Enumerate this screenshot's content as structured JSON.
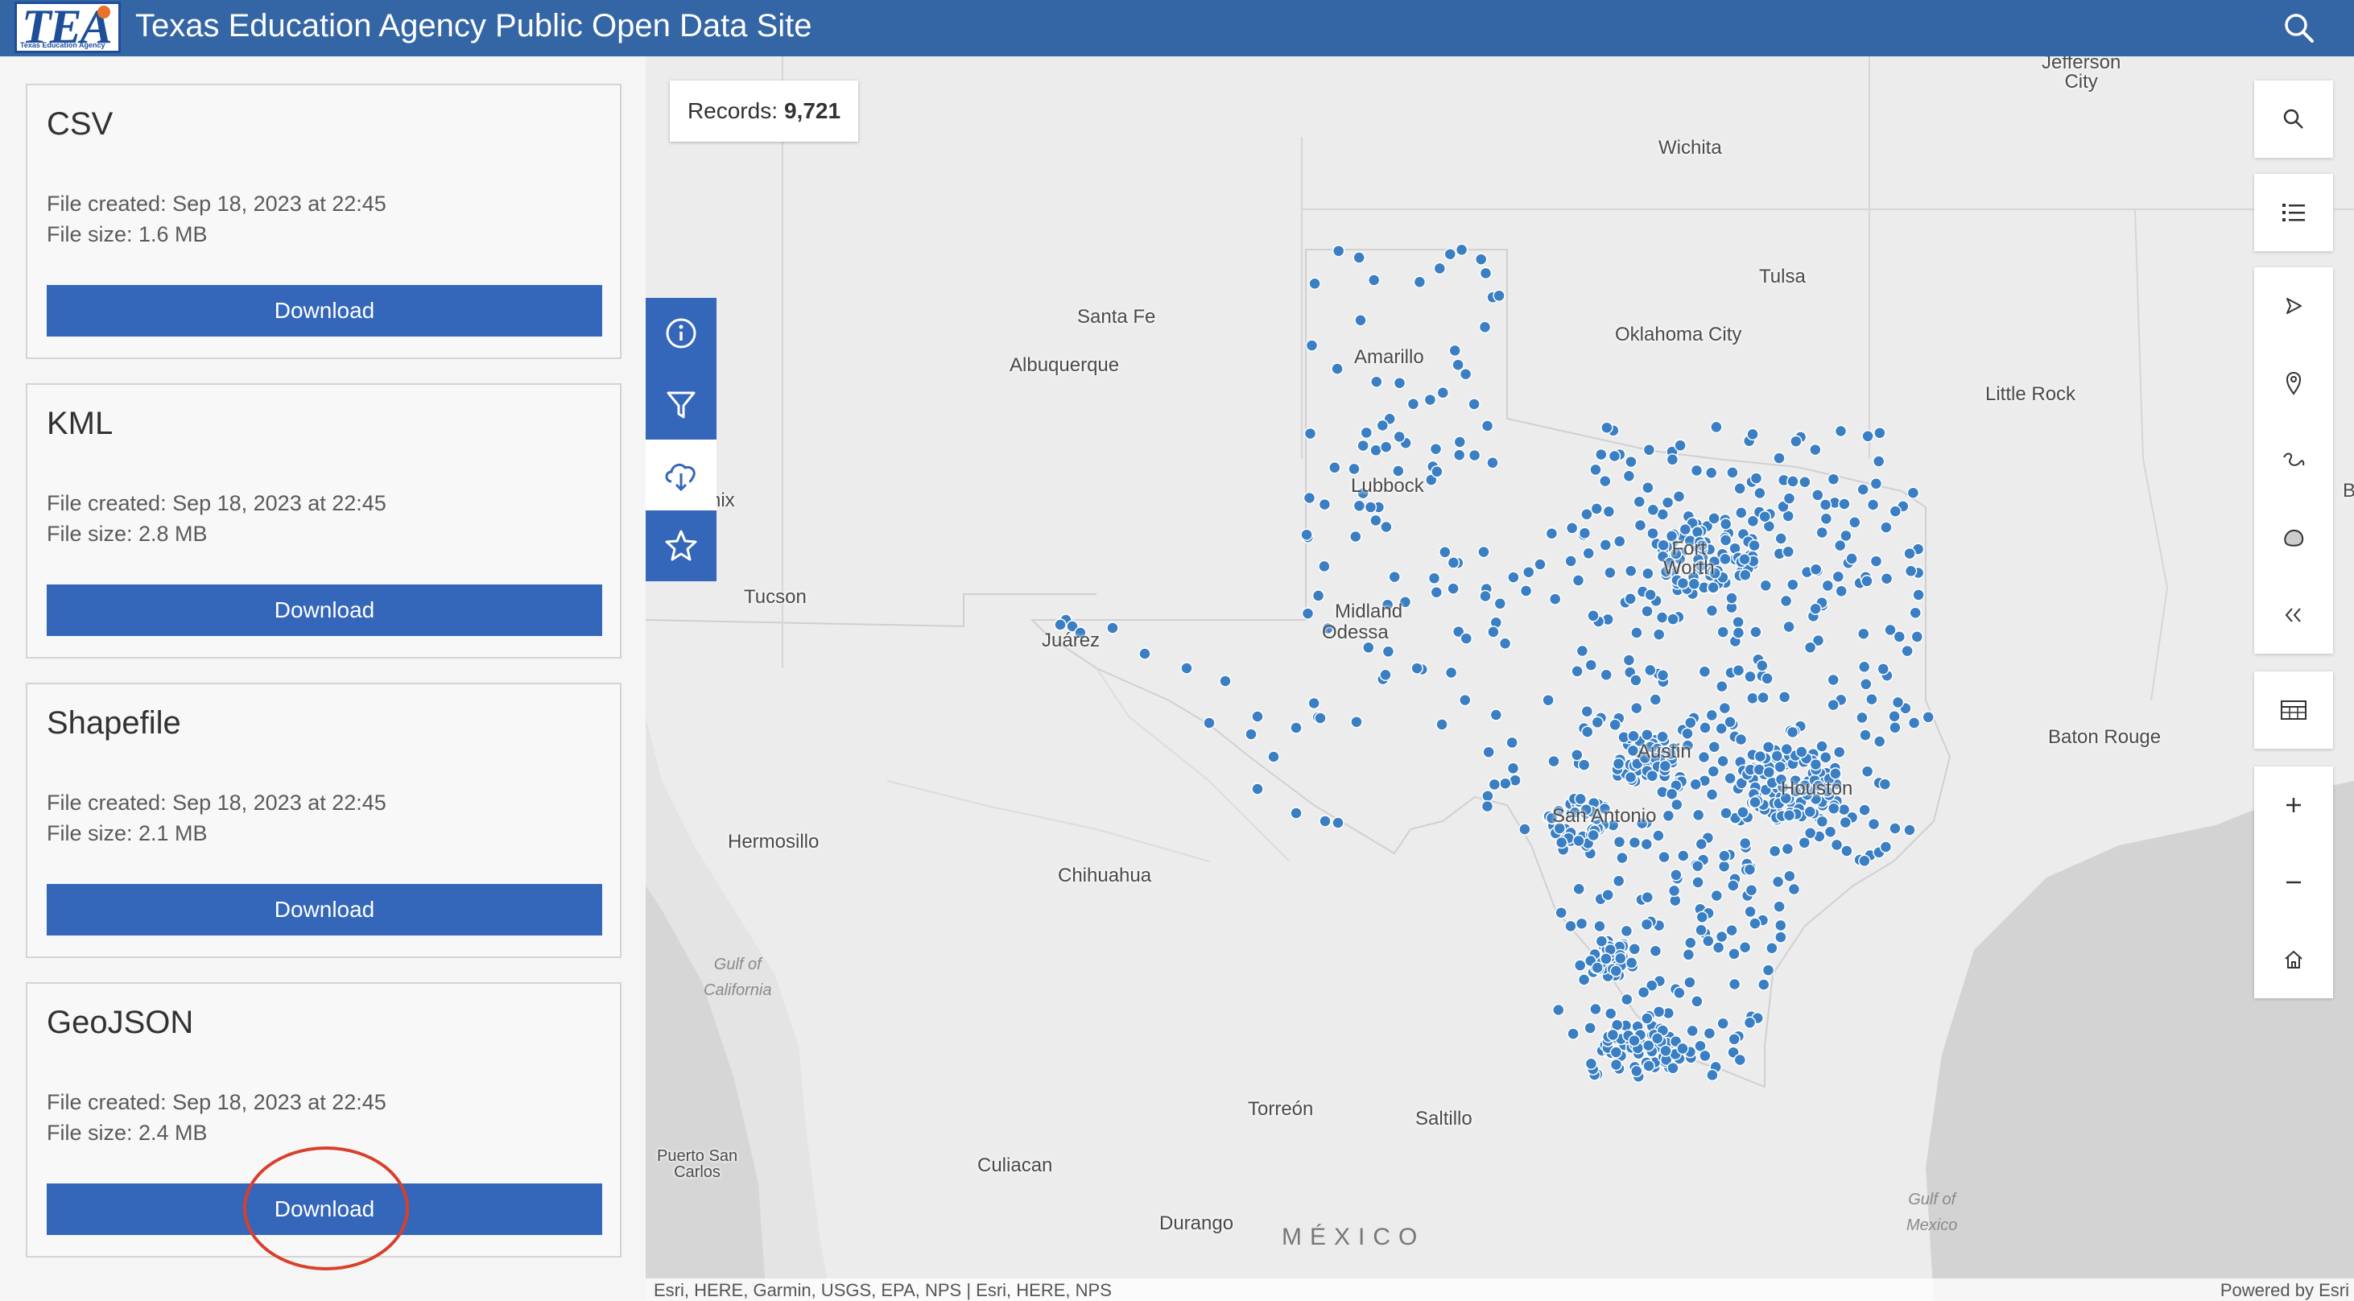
{
  "header": {
    "logo_text": "TEA",
    "logo_subtext": "Texas Education Agency",
    "title": "Texas Education Agency Public Open Data Site",
    "search_icon": "search-icon"
  },
  "downloads": [
    {
      "format": "CSV",
      "created": "File created: Sep 18, 2023 at 22:45",
      "size": "File size: 1.6 MB",
      "button": "Download"
    },
    {
      "format": "KML",
      "created": "File created: Sep 18, 2023 at 22:45",
      "size": "File size: 2.8 MB",
      "button": "Download"
    },
    {
      "format": "Shapefile",
      "created": "File created: Sep 18, 2023 at 22:45",
      "size": "File size: 2.1 MB",
      "button": "Download"
    },
    {
      "format": "GeoJSON",
      "created": "File created: Sep 18, 2023 at 22:45",
      "size": "File size: 2.4 MB",
      "button": "Download"
    }
  ],
  "records": {
    "label": "Records:",
    "value": "9,721"
  },
  "side_toolbar": [
    "info-icon",
    "filter-icon",
    "cloud-download-icon",
    "star-icon"
  ],
  "right_toolbar": [
    "search-icon",
    "list-icon",
    "select-arrow-icon",
    "location-pin-icon",
    "route-icon",
    "area-icon",
    "collapse-icon",
    "table-icon",
    "zoom-in-icon",
    "zoom-out-icon",
    "home-icon"
  ],
  "map": {
    "cities": {
      "jefferson": "Jefferson\nCity",
      "wichita": "Wichita",
      "tulsa": "Tulsa",
      "santa_fe": "Santa Fe",
      "albuquerque": "Albuquerque",
      "okc": "Oklahoma City",
      "little_rock": "Little Rock",
      "amarillo": "Amarillo",
      "phoenix": "nix",
      "lubbock": "Lubbock",
      "tucson": "Tucson",
      "fort_worth": "Fort\nWorth",
      "midland": "Midland",
      "odessa": "Odessa",
      "juarez": "Juárez",
      "baton_rouge": "Baton Rouge",
      "austin": "Austin",
      "houston": "Houston",
      "hermosillo": "Hermosillo",
      "san_antonio": "San Antonio",
      "chihuahua": "Chihuahua",
      "torreon": "Torreón",
      "saltillo": "Saltillo",
      "puerto_san_carlos": "Puerto San\nCarlos",
      "culiacan": "Culiacan",
      "durango": "Durango",
      "edge_b": "B"
    },
    "seas": {
      "gulf_ca": "Gulf of\nCalifornia",
      "gulf_mx": "Gulf of\nMexico"
    },
    "country": "MÉXICO",
    "point_color": "#3a7fc4"
  },
  "attribution": {
    "left": "Esri, HERE, Garmin, USGS, EPA, NPS | Esri, HERE, NPS",
    "right": "Powered by Esri"
  }
}
